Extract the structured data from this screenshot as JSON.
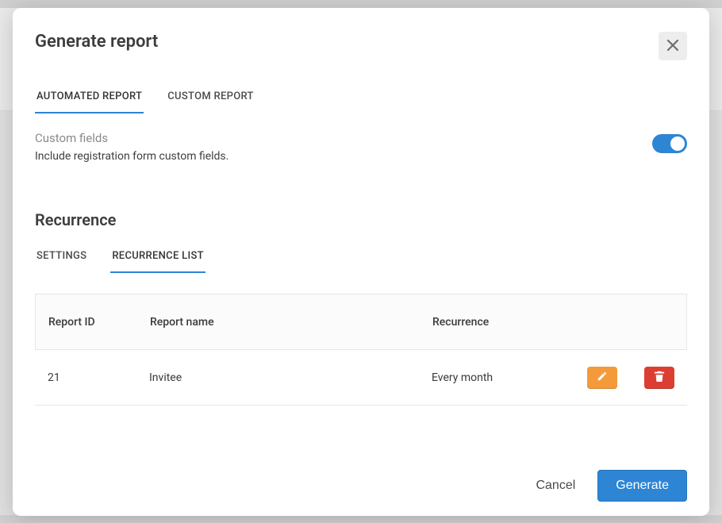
{
  "modal": {
    "title": "Generate report",
    "tabs": [
      {
        "label": "AUTOMATED REPORT",
        "active": true
      },
      {
        "label": "CUSTOM REPORT",
        "active": false
      }
    ],
    "customFields": {
      "label": "Custom fields",
      "description": "Include registration form custom fields.",
      "enabled": true
    },
    "recurrence": {
      "title": "Recurrence",
      "tabs": [
        {
          "label": "SETTINGS",
          "active": false
        },
        {
          "label": "RECURRENCE LIST",
          "active": true
        }
      ],
      "columns": {
        "id": "Report ID",
        "name": "Report name",
        "rec": "Recurrence"
      },
      "rows": [
        {
          "id": "21",
          "name": "Invitee",
          "recurrence": "Every month"
        }
      ]
    },
    "footer": {
      "cancel": "Cancel",
      "generate": "Generate"
    }
  },
  "colors": {
    "accent": "#2e85d4",
    "edit": "#f49a3a",
    "delete": "#dc3f32"
  }
}
